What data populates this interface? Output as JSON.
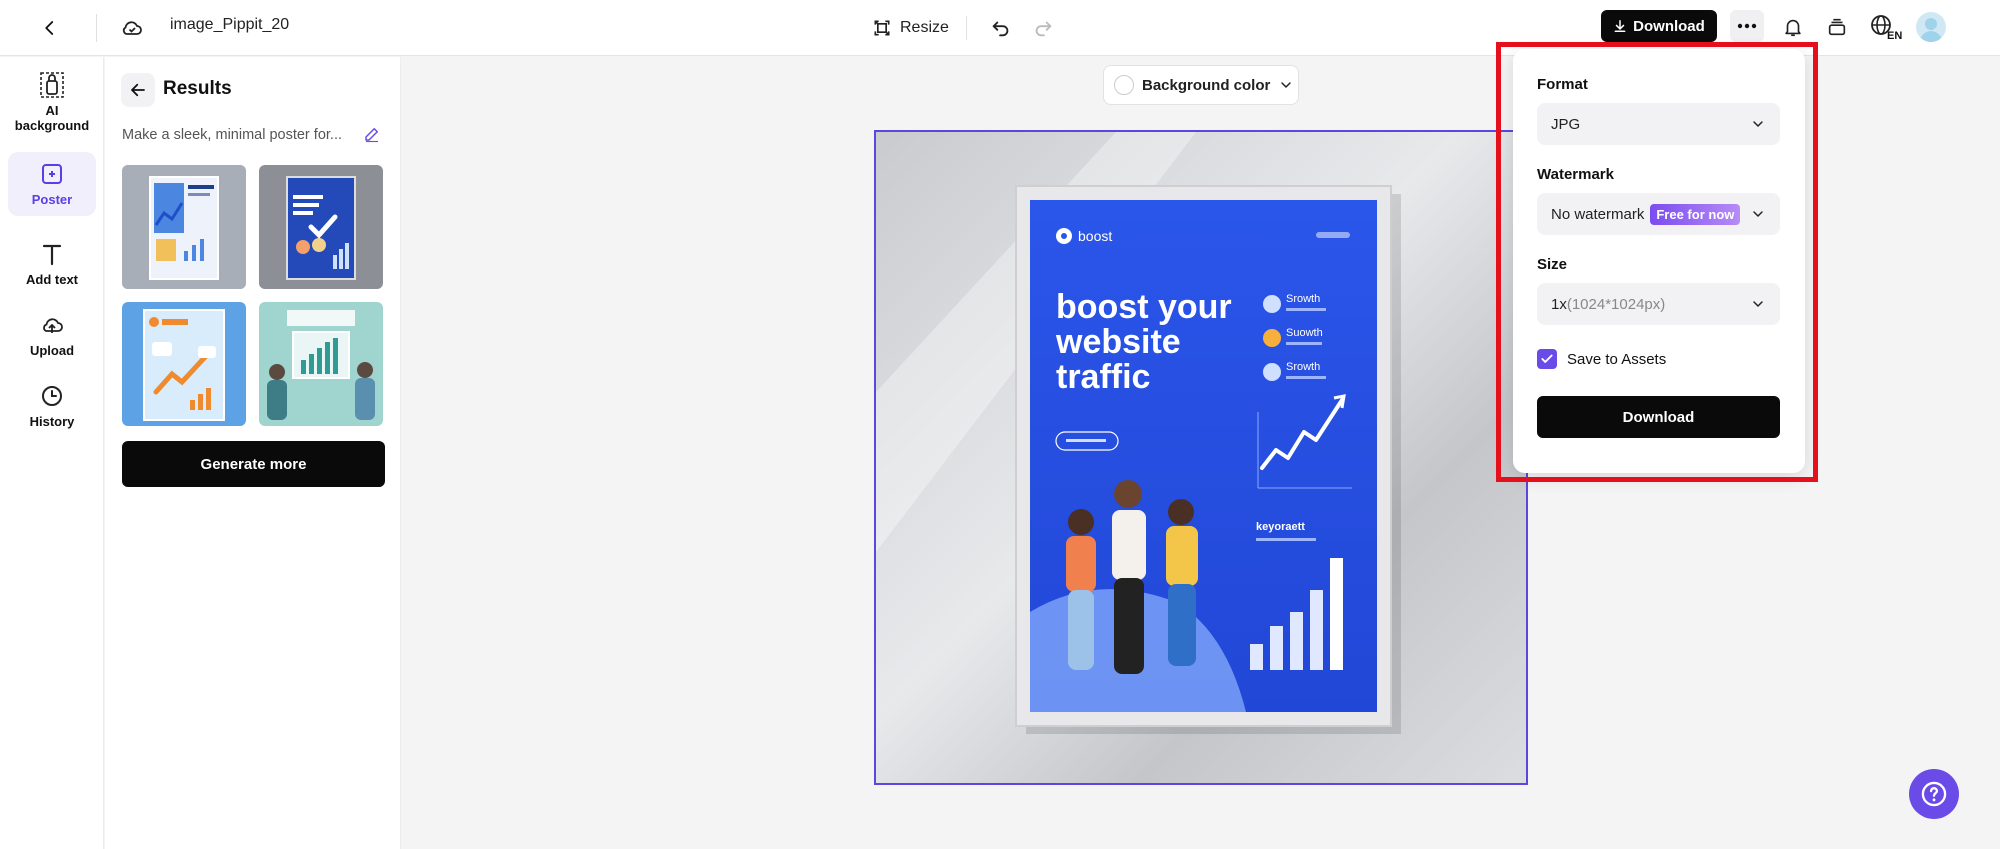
{
  "topbar": {
    "filename": "image_Pippit_20",
    "resize_label": "Resize",
    "download_label": "Download",
    "lang_label": "EN"
  },
  "rail": {
    "items": [
      {
        "label": "AI background",
        "icon": "ai-background-icon"
      },
      {
        "label": "Poster",
        "icon": "poster-icon",
        "active": true
      },
      {
        "label": "Add text",
        "icon": "text-icon"
      },
      {
        "label": "Upload",
        "icon": "upload-icon"
      },
      {
        "label": "History",
        "icon": "clock-icon"
      }
    ]
  },
  "panel": {
    "title": "Results",
    "prompt": "Make a sleek, minimal poster for...",
    "generate_more_label": "Generate more"
  },
  "canvas": {
    "background_color_label": "Background color"
  },
  "download_popover": {
    "format_label": "Format",
    "format_value": "JPG",
    "watermark_label": "Watermark",
    "watermark_value": "No watermark",
    "watermark_badge": "Free for now",
    "size_label": "Size",
    "size_multiplier": "1x",
    "size_dims": "(1024*1024px)",
    "save_to_assets_label": "Save to Assets",
    "save_to_assets_checked": true,
    "download_label": "Download"
  },
  "colors": {
    "accent": "#6a4be8",
    "primary_button": "#0a0a0a",
    "highlight_border": "#e5101c",
    "poster_blue": "#2a55e8"
  }
}
